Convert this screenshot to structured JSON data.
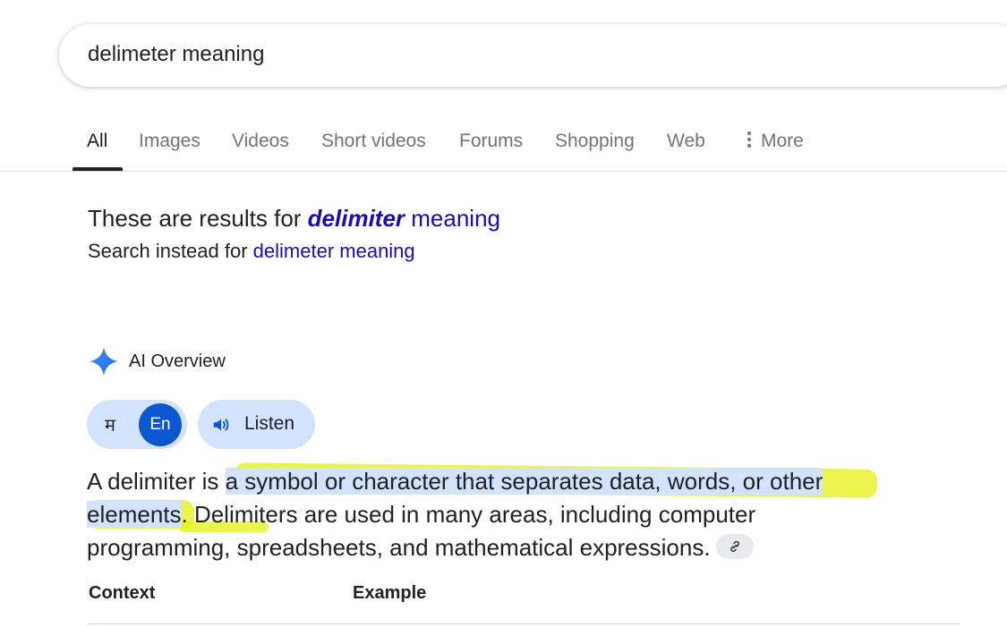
{
  "search": {
    "query": "delimeter meaning"
  },
  "tabs": [
    {
      "label": "All",
      "active": true
    },
    {
      "label": "Images"
    },
    {
      "label": "Videos"
    },
    {
      "label": "Short videos"
    },
    {
      "label": "Forums"
    },
    {
      "label": "Shopping"
    },
    {
      "label": "Web"
    },
    {
      "label": "More",
      "icon": "vertical-dots-icon"
    }
  ],
  "correction": {
    "prefix": "These are results for ",
    "corrected_bold": "delimiter",
    "corrected_rest": " meaning",
    "instead_prefix": "Search instead for ",
    "original_query": "delimeter meaning"
  },
  "ai_overview": {
    "icon": "sparkle-icon",
    "label": "AI Overview",
    "lang_hindi": "म",
    "lang_english": "En",
    "listen_label": "Listen",
    "answer_start": "A delimiter is ",
    "answer_highlight_1": "a symbol or character that separates data, words, or other",
    "answer_highlight_2": "elements",
    "answer_rest": ". Delimiters are used in many areas, including computer programming, spreadsheets, and mathematical expressions."
  },
  "table": {
    "headers": [
      "Context",
      "Example"
    ]
  },
  "colors": {
    "link": "#1a0dab",
    "accent": "#0b57d0",
    "chip_bg": "#d3e3fd",
    "marker": "#e6f01e"
  }
}
